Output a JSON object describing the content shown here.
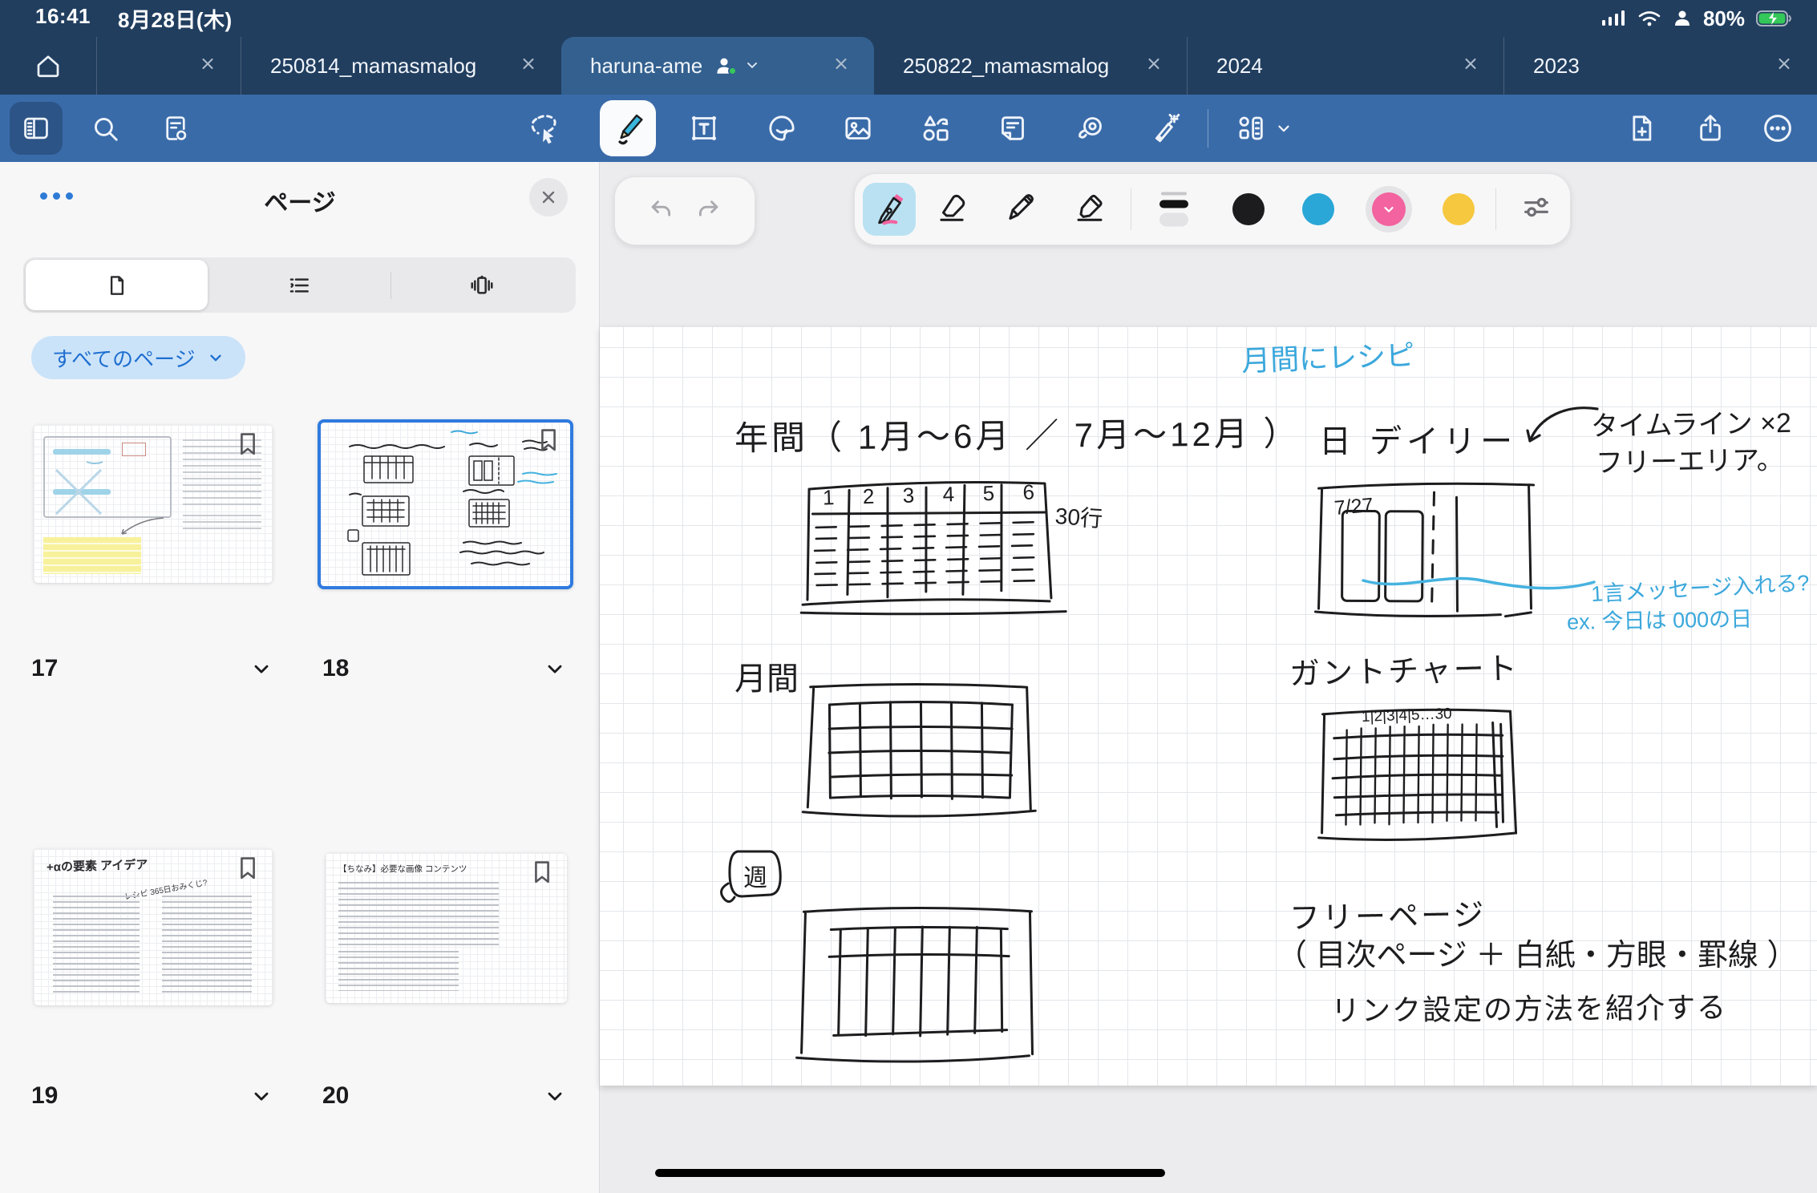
{
  "status_bar": {
    "time": "16:41",
    "date": "8月28日(木)",
    "battery_percent": "80%"
  },
  "tab_bar": {
    "tabs": [
      {
        "label": ""
      },
      {
        "label": "250814_mamasmalog"
      },
      {
        "label": "haruna-ame",
        "active": true,
        "shared": true
      },
      {
        "label": "250822_mamasmalog"
      },
      {
        "label": "2024"
      },
      {
        "label": "2023"
      }
    ]
  },
  "toolbar": {
    "left_icons": [
      "pages-panel",
      "search",
      "page-overview"
    ],
    "center_icons": [
      "lasso",
      "pen",
      "text",
      "sticker",
      "image",
      "shapes",
      "note",
      "zoom-window",
      "laser-pointer",
      "elements"
    ],
    "right_icons": [
      "add-page",
      "share",
      "more"
    ]
  },
  "sidebar": {
    "title": "ページ",
    "filter": {
      "label": "すべてのページ"
    },
    "view_modes": [
      "thumbnails",
      "outline",
      "horizontal-scroll"
    ],
    "pages": [
      {
        "number": "17",
        "bookmarked": true
      },
      {
        "number": "18",
        "bookmarked": true,
        "selected": true
      },
      {
        "number": "19",
        "bookmarked": true,
        "thumb_title": "+αの要素 アイデア",
        "thumb_note": "レシピ 365日おみくじ?"
      },
      {
        "number": "20",
        "bookmarked": true,
        "thumb_title": "【ちなみ】必要な画像 コンテンツ"
      }
    ]
  },
  "pen_toolbar": {
    "tools": [
      "fountain-pen",
      "eraser",
      "pencil",
      "highlighter"
    ],
    "selected_tool": "fountain-pen",
    "selected_tool_bg": "#B9E1F2",
    "colors": [
      {
        "name": "black",
        "hex": "#1C1C1E"
      },
      {
        "name": "cyan",
        "hex": "#2AA7D7"
      },
      {
        "name": "pink",
        "hex": "#F2639F",
        "selected": true
      },
      {
        "name": "yellow",
        "hex": "#F6C83F"
      }
    ]
  },
  "canvas": {
    "ink_black": "#1D1D1F",
    "ink_blue": "#3BA8DC",
    "notes": {
      "monthly_recipe": "月間にレシピ",
      "year_heading": "年間（ 1月〜6月 ／ 7月〜12月 ）",
      "year_columns": [
        "1",
        "2",
        "3",
        "4",
        "5",
        "6"
      ],
      "year_rows_label": "30行",
      "daily_heading": "日 デイリー",
      "timeline_line1": "タイムライン ×2",
      "timeline_line2": "フリーエリア。",
      "daily_date": "7/27",
      "message_line1": "1言メッセージ入れる?",
      "message_line2": "ex. 今日は 000の日",
      "monthly_heading": "月間",
      "gantt_heading": "ガントチャート",
      "gantt_columns": "1|2|3|4|5…30",
      "week_label": "週",
      "free_line1": "フリーページ",
      "free_line2": "（ 目次ページ ＋ 白紙・方眼・罫線 ）",
      "free_line3": "リンク設定の方法を紹介する"
    }
  },
  "theme": {
    "header_bg": "#213E5F",
    "active_tab_bg": "#33608F",
    "toolbar_bg": "#3A6BA9",
    "accent_blue": "#2F7BE0",
    "canvas_bg": "#ECECEE"
  }
}
